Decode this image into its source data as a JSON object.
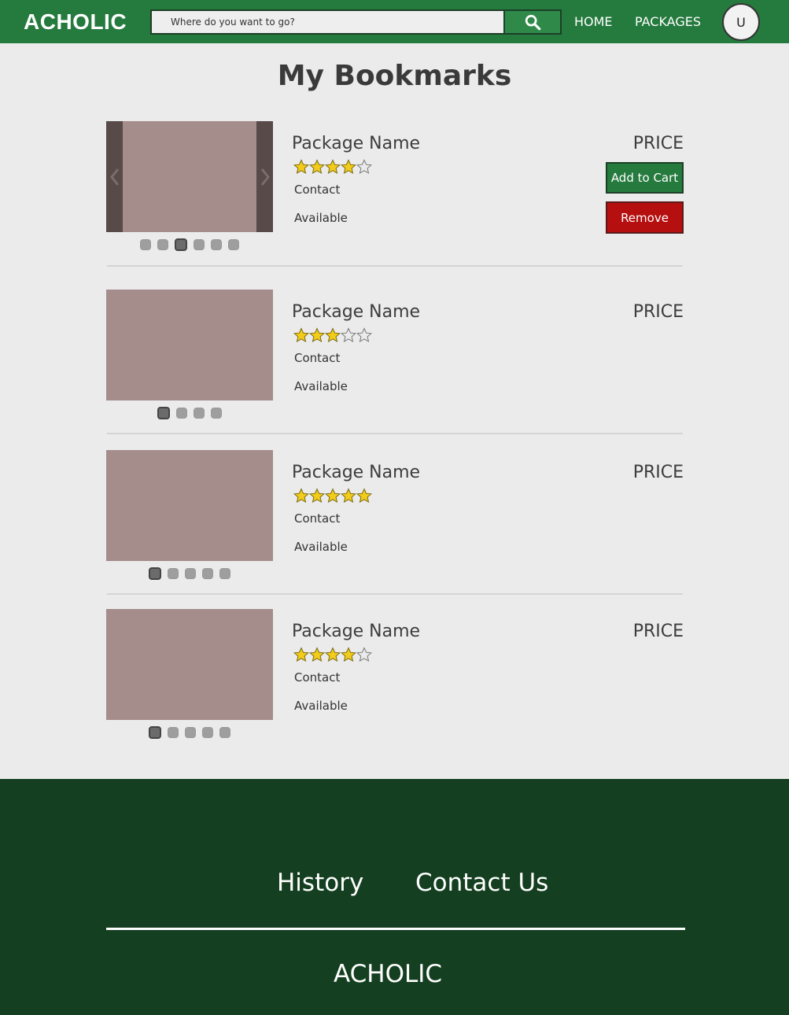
{
  "header": {
    "logo": "ACHOLIC",
    "search_placeholder": "Where do you want to go?",
    "nav": [
      "HOME",
      "PACKAGES"
    ],
    "avatar_initial": "U"
  },
  "page": {
    "title": "My Bookmarks"
  },
  "bookmarks": [
    {
      "name": "Package Name",
      "price": "PRICE",
      "rating": 4,
      "contact": "Contact",
      "availability": "Available",
      "image_count": 6,
      "active_image": 3,
      "add_to_cart_label": "Add to Cart",
      "remove_label": "Remove"
    },
    {
      "name": "Package Name",
      "price": "PRICE",
      "rating": 3,
      "contact": "Contact",
      "availability": "Available",
      "image_count": 4,
      "active_image": 1
    },
    {
      "name": "Package Name",
      "price": "PRICE",
      "rating": 5,
      "contact": "Contact",
      "availability": "Available",
      "image_count": 5,
      "active_image": 1
    },
    {
      "name": "Package Name",
      "price": "PRICE",
      "rating": 4,
      "contact": "Contact",
      "availability": "Available",
      "image_count": 5,
      "active_image": 1
    }
  ],
  "footer": {
    "links": [
      "History",
      "Contact Us"
    ],
    "logo": "ACHOLIC"
  },
  "icons": {
    "search": "search-icon",
    "prev": "chevron-left-icon",
    "next": "chevron-right-icon",
    "star": "star-icon"
  },
  "colors": {
    "brand_green": "#257a3e",
    "footer_green": "#143f20",
    "remove_red": "#b50f0f",
    "star_yellow": "#f2cc19",
    "thumb": "#a58d8b"
  }
}
